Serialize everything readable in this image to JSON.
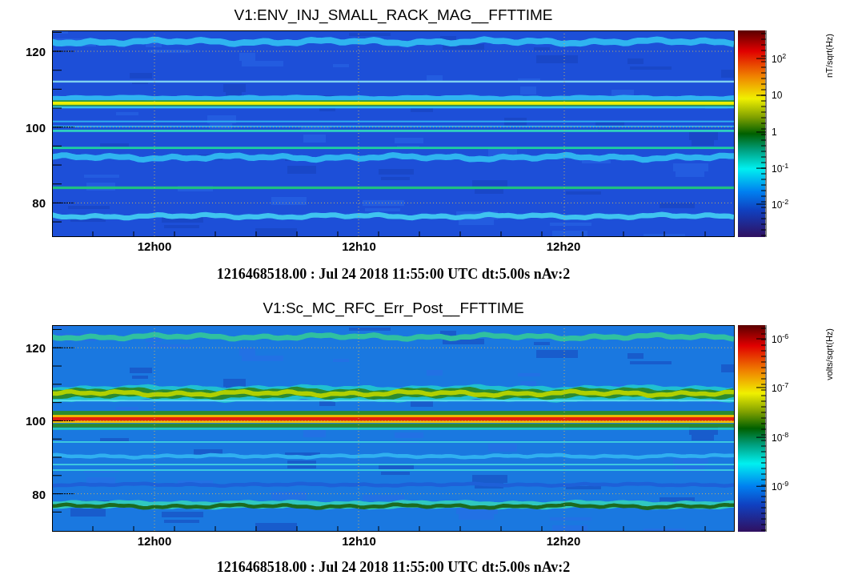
{
  "panels": [
    {
      "title": "V1:ENV_INJ_SMALL_RACK_MAG__FFTTIME",
      "y_ticks": [
        "120",
        "100",
        "80"
      ],
      "x_ticks": [
        "12h00",
        "12h10",
        "12h20"
      ],
      "colorbar_ticks": [
        "10$^{2}$",
        "10",
        "1",
        "10$^{-1}$",
        "10$^{-2}$"
      ],
      "colorbar_unit": "nT/sqrt(Hz)",
      "footer": "1216468518.00 : Jul 24 2018 11:55:00 UTC dt:5.00s nAv:2"
    },
    {
      "title": "V1:Sc_MC_RFC_Err_Post__FFTTIME",
      "y_ticks": [
        "120",
        "100",
        "80"
      ],
      "x_ticks": [
        "12h00",
        "12h10",
        "12h20"
      ],
      "colorbar_ticks": [
        "10$^{-6}$",
        "10$^{-7}$",
        "10$^{-8}$",
        "10$^{-9}$"
      ],
      "colorbar_unit": "volts/sqrt(Hz)",
      "footer": "1216468518.00 : Jul 24 2018 11:55:00 UTC dt:5.00s nAv:2"
    }
  ]
}
